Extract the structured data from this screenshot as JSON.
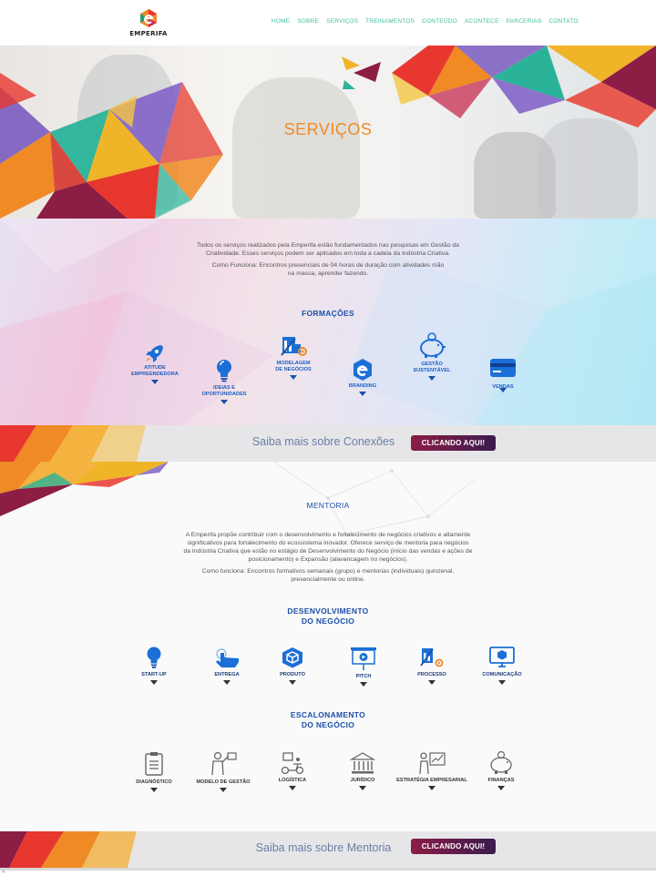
{
  "brand": {
    "name": "EMPERIFA"
  },
  "nav": [
    "HOME",
    "SOBRE",
    "SERVIÇOS",
    "TREINAMENTOS",
    "CONTEÚDO",
    "ACONTECE",
    "PARCERIAS",
    "CONTATO"
  ],
  "hero": {
    "title": "SERVIÇOS"
  },
  "formacoes": {
    "intro": "Todos os serviços realizados pela Emperifa estão fundamentados nas pesquisas em Gestão da Criatividade. Esses serviços podem ser aplicados em toda a cadeia da Indústria Criativa.",
    "how_1": "Como Funciona: Encontros presenciais de 04 horas de duração com atividades mão",
    "how_2": "na massa, aprender fazendo.",
    "title": "FORMAÇÕES",
    "items": [
      {
        "l1": "ATITUDE",
        "l2": "EMPREENDEDORA",
        "icon": "rocket-icon"
      },
      {
        "l1": "IDEIAS E",
        "l2": "OPORTUNIDADES",
        "icon": "lightbulb-icon"
      },
      {
        "l1": "MODELAGEM",
        "l2": "DE NEGÓCIOS",
        "icon": "business-model-icon"
      },
      {
        "l1": "BRANDING",
        "l2": "",
        "icon": "brand-icon"
      },
      {
        "l1": "GESTÃO",
        "l2": "SUSTENTÁVEL",
        "icon": "piggy-bank-icon"
      },
      {
        "l1": "VENDAS",
        "l2": "",
        "icon": "credit-card-icon"
      }
    ]
  },
  "banner1": {
    "text": "Saiba mais sobre Conexões",
    "cta": "CLICANDO AQUI!"
  },
  "mentoria": {
    "title": "MENTORIA",
    "p1": "A Emperifa propõe contribuir com o desenvolvimento e fortalecimento de negócios criativos e altamente",
    "p2": "significativos para fortalecimento do ecossistema inovador. Oferece serviço de mentoria para negócios",
    "p3": "da Indústria Criativa que estão no estágio de Desenvolvimento do Negócio (início das vendas e ações de",
    "p4": "posicionamento) e Expansão (alavancagem no negócios).",
    "how_1": "Como funciona: Encontros formativos semanais (grupo) e mentorias (individuais) quinzenal,",
    "how_2": "presencialmente ou online.",
    "dev_title_1": "DESENVOLVIMENTO",
    "dev_title_2": "DO NEGÓCIO",
    "dev_items": [
      {
        "label": "START-UP",
        "icon": "lightbulb-icon"
      },
      {
        "label": "ENTREGA",
        "icon": "hand-tap-icon"
      },
      {
        "label": "PRODUTO",
        "icon": "box-icon"
      },
      {
        "label": "PITCH",
        "icon": "presentation-icon"
      },
      {
        "label": "PROCESSO",
        "icon": "process-icon"
      },
      {
        "label": "COMUNICAÇÃO",
        "icon": "monitor-box-icon"
      }
    ],
    "esc_title_1": "ESCALONAMENTO",
    "esc_title_2": "DO NEGÓCIO",
    "esc_items": [
      {
        "label": "DIAGNÓSTICO",
        "icon": "clipboard-icon"
      },
      {
        "label": "MODELO DE GESTÃO",
        "icon": "manager-board-icon"
      },
      {
        "label": "LOGÍSTICA",
        "icon": "delivery-icon"
      },
      {
        "label": "JURÍDICO",
        "icon": "courthouse-icon"
      },
      {
        "label": "ESTRATÉGIA EMPRESARIAL",
        "icon": "strategy-chart-icon"
      },
      {
        "label": "FINANÇAS",
        "icon": "piggy-bank-icon"
      }
    ]
  },
  "banner2": {
    "text": "Saiba mais sobre Mentoria",
    "cta": "CLICANDO AQUI!"
  },
  "colors": {
    "accent": "#f08a25",
    "nav": "#3fbf9f",
    "blue": "#1b5fc4",
    "cta_start": "#8c1d45",
    "cta_end": "#3a1b4f"
  }
}
